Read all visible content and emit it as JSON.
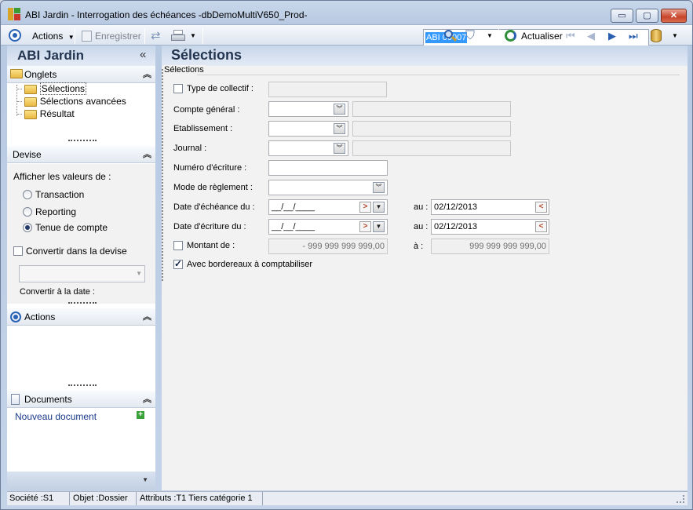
{
  "window": {
    "title": "ABI Jardin -  Interrogation des échéances -dbDemoMultiV650_Prod-",
    "min_label": "▭",
    "max_label": "▢",
    "close_label": "✕"
  },
  "toolbar": {
    "actions_label": "Actions",
    "save_label": "Enregistrer",
    "code_value": "ABI 00007",
    "refresh_label": "Actualiser"
  },
  "sidebar": {
    "app_name": "ABI Jardin",
    "collapse_glyph": "«",
    "onglets": {
      "title": "Onglets",
      "items": [
        "Sélections",
        "Sélections avancées",
        "Résultat"
      ]
    },
    "devise": {
      "title": "Devise",
      "show_values_label": "Afficher les valeurs de :",
      "options": [
        "Transaction",
        "Reporting",
        "Tenue de compte"
      ],
      "selected": "Tenue de compte",
      "convert_label": "Convertir dans la devise",
      "convert_date_label": "Convertir à la date :"
    },
    "actions": {
      "title": "Actions"
    },
    "documents": {
      "title": "Documents",
      "new_label": "Nouveau document"
    }
  },
  "main": {
    "title": "Sélections",
    "group_label": "Sélections",
    "type_collectif_label": "Type de collectif :",
    "compte_general_label": "Compte général :",
    "etablissement_label": "Etablissement :",
    "journal_label": "Journal :",
    "numero_ecriture_label": "Numéro d'écriture :",
    "mode_reglement_label": "Mode de règlement :",
    "date_echeance_label": "Date d'échéance du :",
    "date_echeance_from": "__/__/____",
    "date_echeance_to_label": "au :",
    "date_echeance_to": "02/12/2013",
    "date_ecriture_label": "Date d'écriture du :",
    "date_ecriture_from": "__/__/____",
    "date_ecriture_to_label": "au :",
    "date_ecriture_to": "02/12/2013",
    "montant_label": "Montant de :",
    "montant_from": "- 999 999 999 999,00",
    "montant_to_label": "à :",
    "montant_to": "999 999 999 999,00",
    "bordereaux_label": "Avec bordereaux à comptabiliser"
  },
  "status": {
    "societe": "Société :S1",
    "objet": "Objet :Dossier",
    "attributs": "Attributs :T1 Tiers catégorie 1"
  }
}
